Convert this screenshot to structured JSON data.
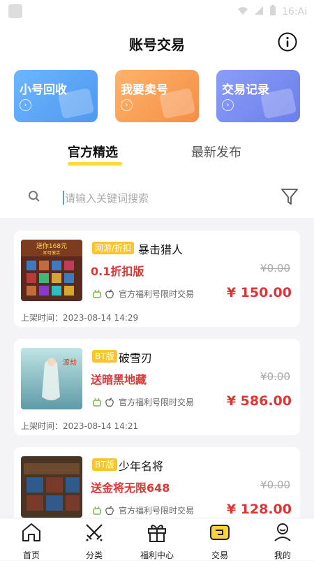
{
  "status_bar": {
    "time": "16:Ai"
  },
  "header": {
    "title": "账号交易"
  },
  "cards": [
    {
      "label": "小号回收",
      "color": "#5aa7f5"
    },
    {
      "label": "我要卖号",
      "color": "#f8a155"
    },
    {
      "label": "交易记录",
      "color": "#7a8ef0"
    }
  ],
  "tabs": [
    {
      "label": "官方精选",
      "active": true
    },
    {
      "label": "最新发布",
      "active": false
    }
  ],
  "search": {
    "placeholder": "请输入关键词搜索"
  },
  "listings": [
    {
      "tag": "网游/折扣",
      "name": "暴击猎人",
      "promo": "0.1折扣版",
      "original_price": "¥0.00",
      "note": "官方福利号限时交易",
      "price": "¥ 150.00",
      "time": "上架时间：2023-08-14 14:29"
    },
    {
      "tag": "BT版",
      "name": "破雪刃",
      "promo": "送暗黑地藏",
      "original_price": "¥0.00",
      "note": "官方福利号限时交易",
      "price": "¥ 586.00",
      "time": "上架时间：2023-08-14 14:21"
    },
    {
      "tag": "BT版",
      "name": "少年名将",
      "promo": "送金将无限648",
      "original_price": "¥0.00",
      "note": "官方福利号限时交易",
      "price": "¥ 128.00",
      "time": ""
    }
  ],
  "thumb_texts": {
    "t1_banner": "送你168元",
    "t1_sub": "即可激活",
    "t2_text": "渡劫"
  },
  "bottom_nav": [
    {
      "label": "首页",
      "icon": "home-icon"
    },
    {
      "label": "分类",
      "icon": "swords-icon"
    },
    {
      "label": "福利中心",
      "icon": "gift-icon"
    },
    {
      "label": "交易",
      "icon": "trade-icon"
    },
    {
      "label": "我的",
      "icon": "user-icon"
    }
  ]
}
